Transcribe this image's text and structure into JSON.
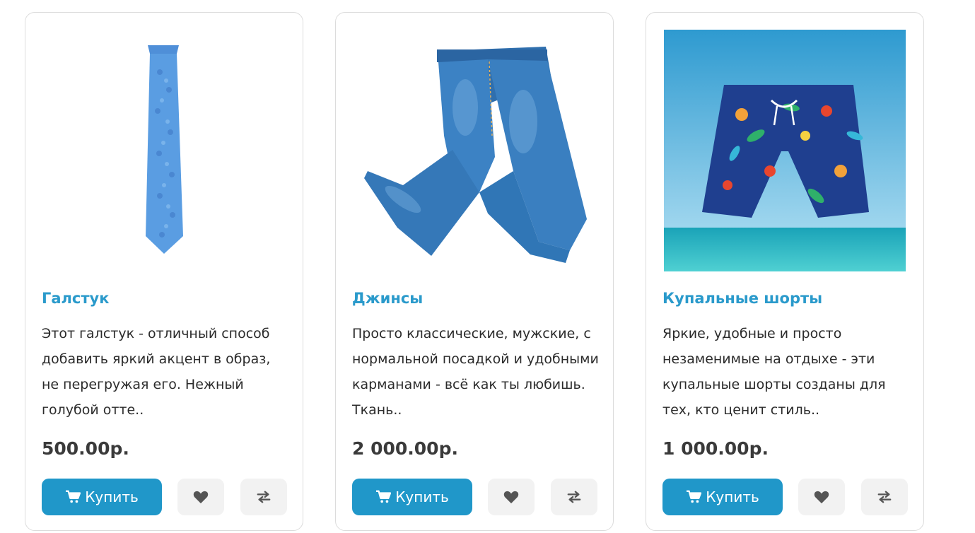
{
  "products": [
    {
      "title": "Галстук",
      "description": "Этот галстук - отличный способ добавить яркий акцент в образ, не перегружая его. Нежный голубой отте..",
      "price": "500.00р.",
      "buy_label": "Купить"
    },
    {
      "title": "Джинсы",
      "description": "Просто классические, мужские, с нормальной посадкой и удобными карманами - всё как ты любишь. Ткань..",
      "price": "2 000.00р.",
      "buy_label": "Купить"
    },
    {
      "title": "Купальные шорты",
      "description": "Яркие, удобные и просто незаменимые на отдыхе - эти купальные шорты созданы для тех, кто ценит стиль..",
      "price": "1 000.00р.",
      "buy_label": "Купить"
    }
  ],
  "icons": {
    "cart": "cart-icon",
    "wishlist": "heart-icon",
    "compare": "compare-arrows-icon"
  },
  "colors": {
    "accent": "#2097c9",
    "title": "#2a9acb",
    "price": "#3a3a3a",
    "icon_button_bg": "#f2f2f2"
  }
}
